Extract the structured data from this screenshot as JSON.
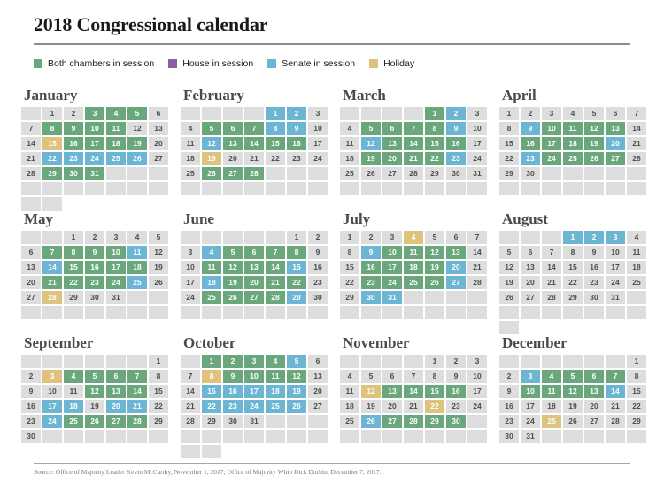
{
  "title": "2018 Congressional calendar",
  "legend": {
    "items": [
      {
        "label": "Both chambers in  session",
        "color": "#6ba77c",
        "key": "both"
      },
      {
        "label": "House in  session",
        "color": "#8e5ea2",
        "key": "house"
      },
      {
        "label": "Senate in  session",
        "color": "#6cb6d4",
        "key": "senate"
      },
      {
        "label": "Holiday",
        "color": "#ddc37e",
        "key": "holiday"
      }
    ]
  },
  "colors": {
    "both": "#6ba77c",
    "house": "#8e5ea2",
    "senate": "#6cb6d4",
    "holiday": "#ddc37e",
    "none": "#dddddd",
    "rule": "#8c8c8c"
  },
  "source": "Source: Office of Majority Leader Kevin McCarthy, November 1, 2017; Office of Majority Whip Dick Durbin, December 7, 2017.",
  "calendar": {
    "year": 2018,
    "months": [
      {
        "name": "January",
        "lead_blanks": 1,
        "trailing_blanks": 12,
        "days": 31,
        "status": {
          "3": "both",
          "4": "both",
          "5": "both",
          "8": "both",
          "9": "both",
          "10": "both",
          "11": "both",
          "15": "holiday",
          "16": "both",
          "17": "both",
          "18": "both",
          "19": "both",
          "22": "senate",
          "23": "senate",
          "24": "senate",
          "25": "senate",
          "26": "senate",
          "29": "both",
          "30": "both",
          "31": "both"
        }
      },
      {
        "name": "February",
        "lead_blanks": 4,
        "trailing_blanks": 10,
        "days": 28,
        "status": {
          "1": "senate",
          "2": "senate",
          "5": "both",
          "6": "both",
          "7": "both",
          "8": "senate",
          "9": "senate",
          "12": "senate",
          "13": "both",
          "14": "both",
          "15": "both",
          "16": "both",
          "19": "holiday",
          "26": "both",
          "27": "both",
          "28": "both"
        }
      },
      {
        "name": "March",
        "lead_blanks": 4,
        "trailing_blanks": 7,
        "days": 31,
        "status": {
          "1": "both",
          "2": "senate",
          "5": "both",
          "6": "both",
          "7": "both",
          "8": "both",
          "9": "senate",
          "12": "senate",
          "13": "both",
          "14": "both",
          "15": "both",
          "16": "both",
          "19": "both",
          "20": "both",
          "21": "both",
          "22": "both",
          "23": "senate"
        }
      },
      {
        "name": "April",
        "lead_blanks": 0,
        "trailing_blanks": 12,
        "days": 30,
        "status": {
          "9": "senate",
          "10": "both",
          "11": "both",
          "12": "both",
          "13": "both",
          "16": "both",
          "17": "both",
          "18": "both",
          "19": "both",
          "20": "senate",
          "23": "senate",
          "24": "both",
          "25": "both",
          "26": "both",
          "27": "both"
        }
      },
      {
        "name": "May",
        "lead_blanks": 2,
        "trailing_blanks": 9,
        "days": 31,
        "status": {
          "7": "both",
          "8": "both",
          "9": "both",
          "10": "both",
          "11": "senate",
          "14": "senate",
          "15": "both",
          "16": "both",
          "17": "both",
          "18": "both",
          "21": "both",
          "22": "both",
          "23": "both",
          "24": "both",
          "25": "senate",
          "28": "holiday"
        }
      },
      {
        "name": "June",
        "lead_blanks": 5,
        "trailing_blanks": 7,
        "days": 30,
        "status": {
          "4": "senate",
          "5": "both",
          "6": "both",
          "7": "both",
          "8": "both",
          "11": "both",
          "12": "both",
          "13": "both",
          "14": "both",
          "15": "senate",
          "18": "senate",
          "19": "both",
          "20": "both",
          "21": "both",
          "22": "both",
          "25": "both",
          "26": "both",
          "27": "both",
          "28": "both",
          "29": "senate"
        }
      },
      {
        "name": "July",
        "lead_blanks": 0,
        "trailing_blanks": 11,
        "days": 31,
        "status": {
          "4": "holiday",
          "9": "senate",
          "10": "both",
          "11": "both",
          "12": "both",
          "13": "both",
          "16": "both",
          "17": "both",
          "18": "both",
          "19": "both",
          "20": "senate",
          "23": "both",
          "24": "both",
          "25": "both",
          "26": "both",
          "27": "senate",
          "30": "senate",
          "31": "senate"
        }
      },
      {
        "name": "August",
        "lead_blanks": 3,
        "trailing_blanks": 9,
        "days": 31,
        "status": {
          "1": "senate",
          "2": "senate",
          "3": "senate"
        }
      },
      {
        "name": "September",
        "lead_blanks": 6,
        "trailing_blanks": 6,
        "days": 30,
        "status": {
          "3": "holiday",
          "4": "both",
          "5": "both",
          "6": "both",
          "7": "both",
          "12": "both",
          "13": "both",
          "14": "both",
          "17": "senate",
          "18": "senate",
          "20": "senate",
          "21": "senate",
          "24": "senate",
          "25": "both",
          "26": "both",
          "27": "both",
          "28": "both"
        }
      },
      {
        "name": "October",
        "lead_blanks": 1,
        "trailing_blanks": 12,
        "days": 31,
        "status": {
          "1": "both",
          "2": "both",
          "3": "both",
          "4": "both",
          "5": "senate",
          "8": "holiday",
          "9": "both",
          "10": "both",
          "11": "both",
          "12": "both",
          "15": "senate",
          "16": "senate",
          "17": "senate",
          "18": "senate",
          "19": "senate",
          "22": "senate",
          "23": "senate",
          "24": "senate",
          "25": "senate",
          "26": "senate"
        }
      },
      {
        "name": "November",
        "lead_blanks": 4,
        "trailing_blanks": 8,
        "days": 30,
        "status": {
          "12": "holiday",
          "13": "both",
          "14": "both",
          "15": "both",
          "16": "both",
          "22": "holiday",
          "26": "senate",
          "27": "both",
          "28": "both",
          "29": "both",
          "30": "both"
        }
      },
      {
        "name": "December",
        "lead_blanks": 6,
        "trailing_blanks": 5,
        "days": 31,
        "status": {
          "3": "senate",
          "4": "both",
          "5": "both",
          "6": "both",
          "7": "both",
          "10": "both",
          "11": "both",
          "12": "both",
          "13": "both",
          "14": "senate",
          "25": "holiday"
        }
      }
    ]
  }
}
